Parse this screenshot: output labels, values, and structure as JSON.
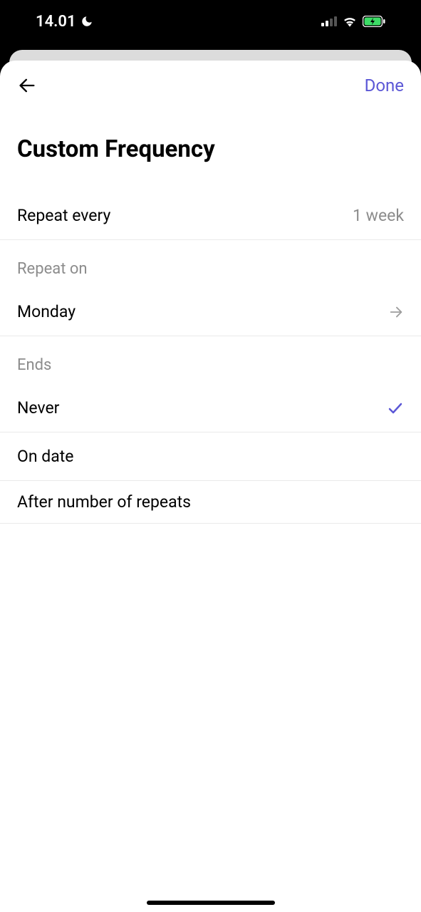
{
  "statusBar": {
    "time": "14.01"
  },
  "nav": {
    "done": "Done"
  },
  "title": "Custom Frequency",
  "repeatEvery": {
    "label": "Repeat every",
    "value": "1 week"
  },
  "repeatOn": {
    "header": "Repeat on",
    "value": "Monday"
  },
  "ends": {
    "header": "Ends",
    "options": [
      {
        "label": "Never",
        "selected": true
      },
      {
        "label": "On date",
        "selected": false
      },
      {
        "label": "After number of repeats",
        "selected": false
      }
    ]
  },
  "colors": {
    "accent": "#5b57d6",
    "secondaryText": "#8c8c8c"
  }
}
